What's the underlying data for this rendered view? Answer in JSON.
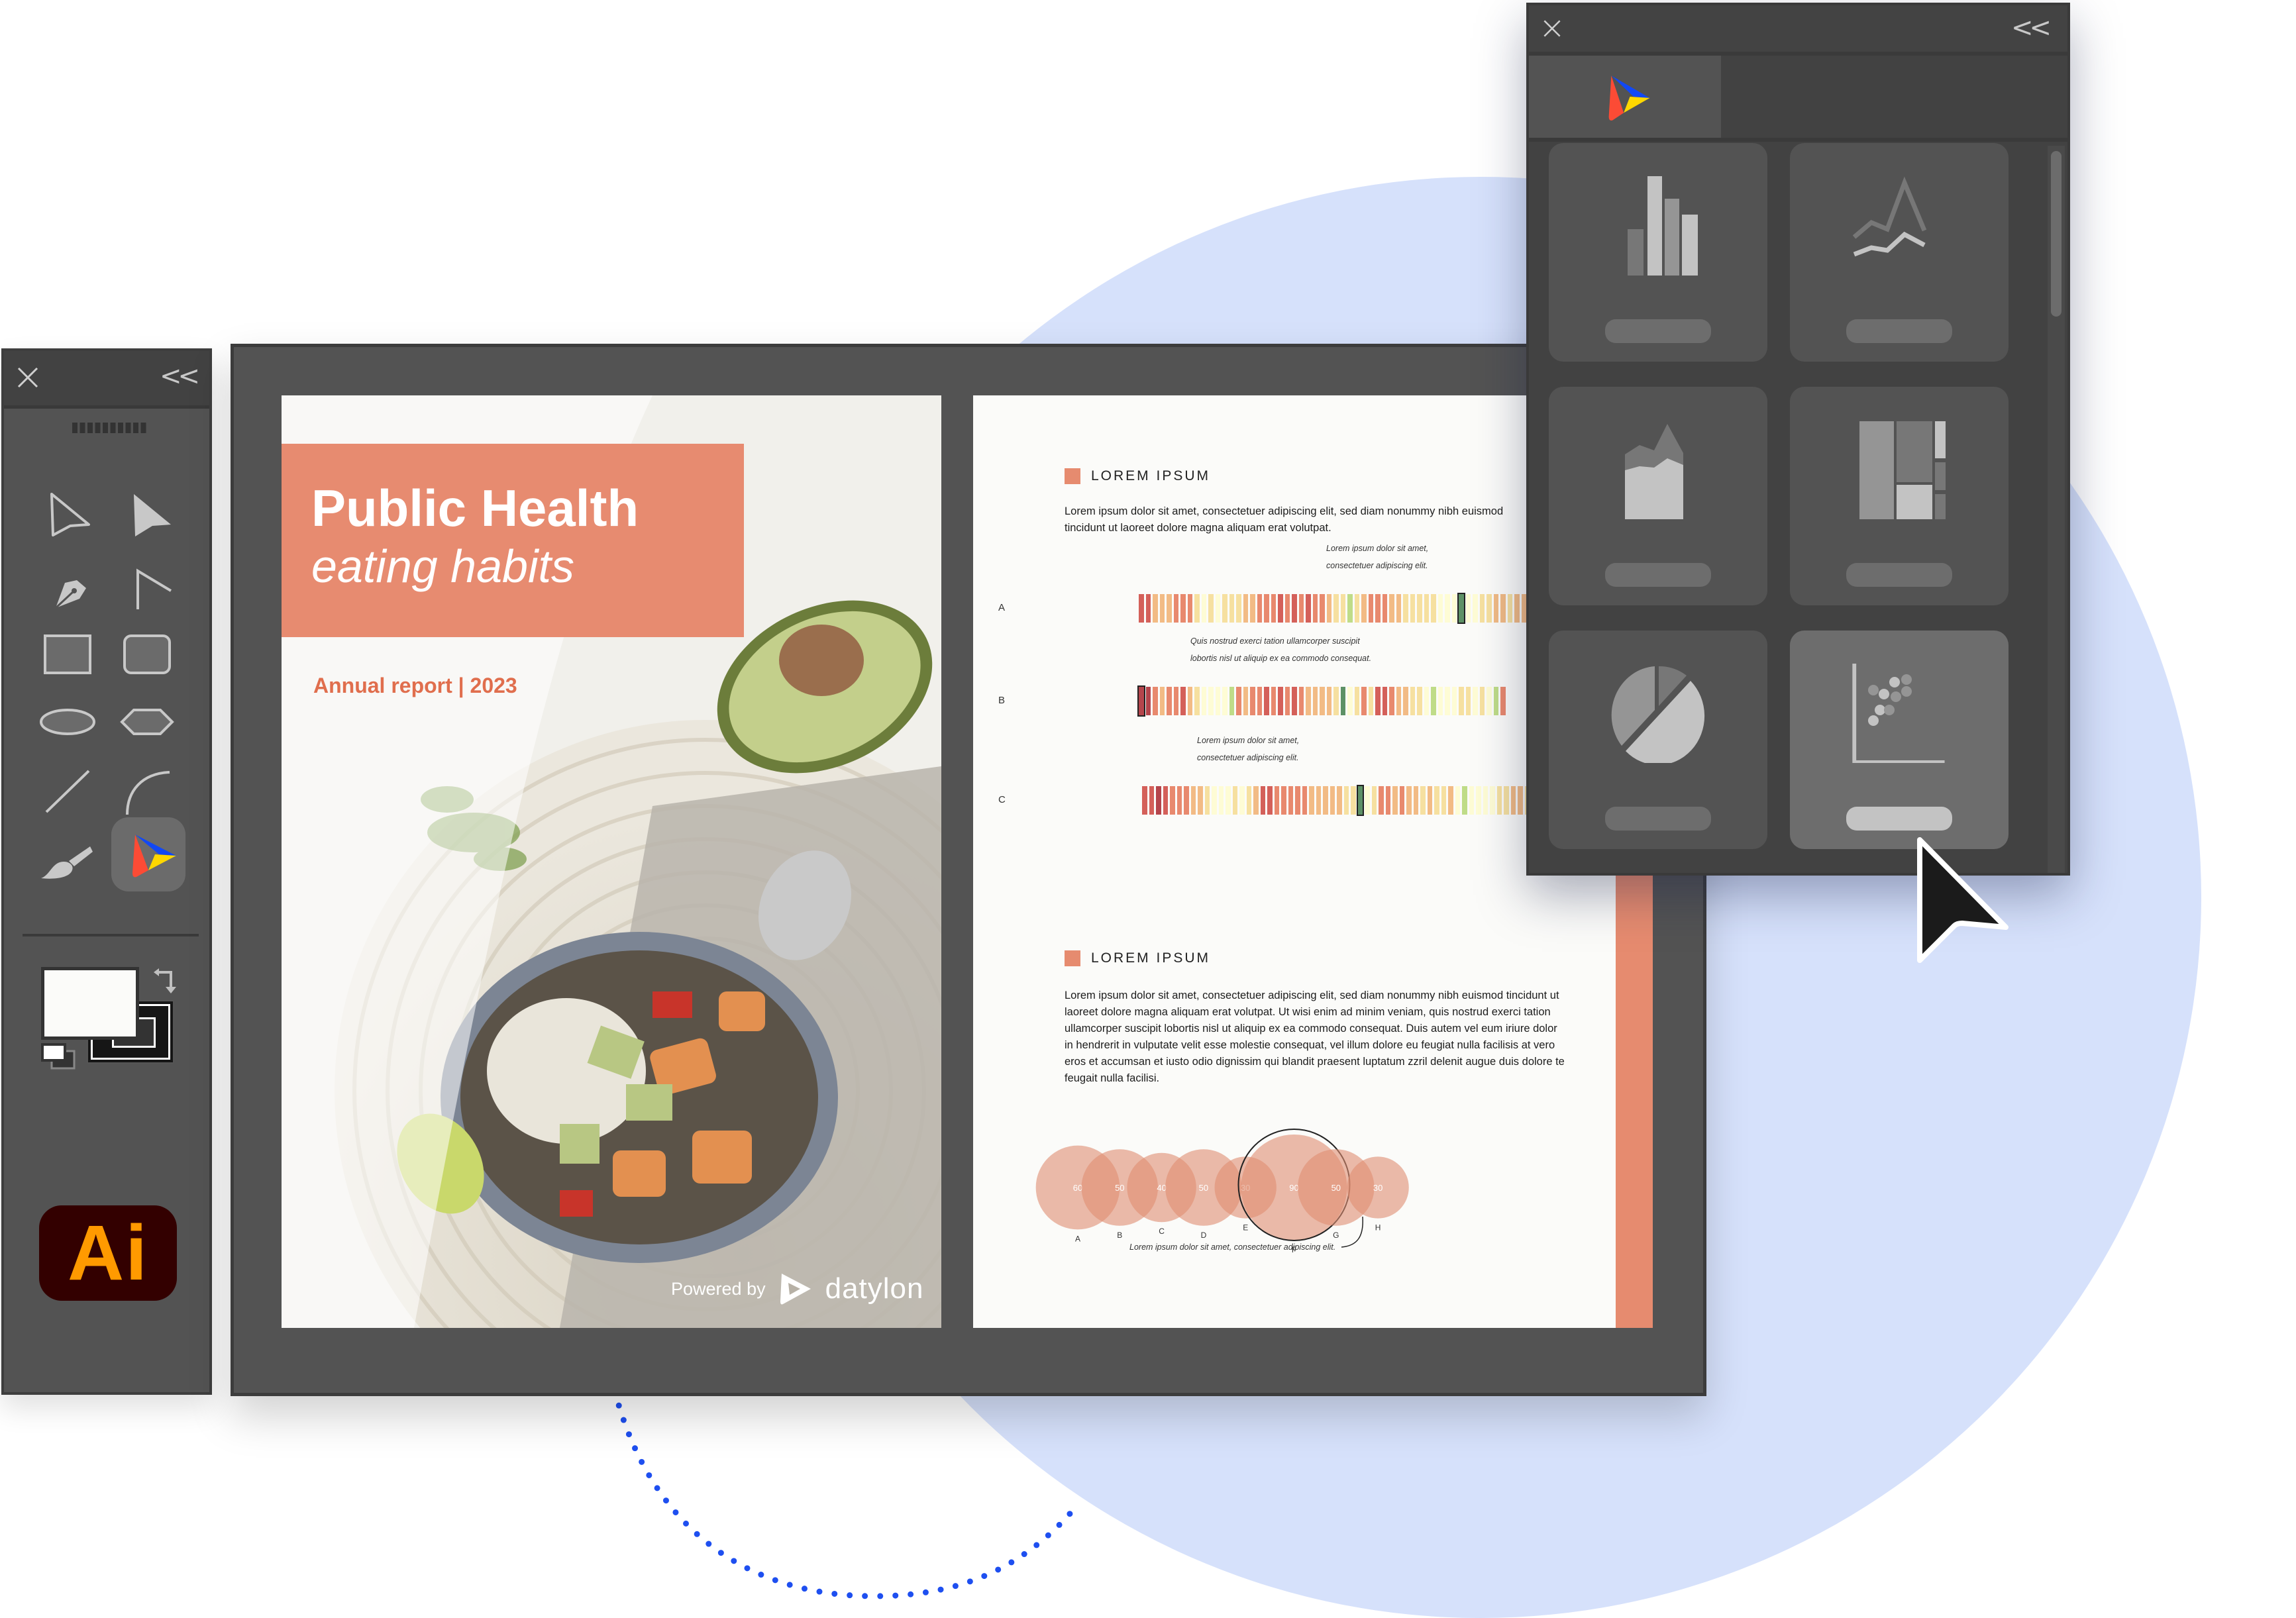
{
  "colors": {
    "accent_coral": "#e68b6f",
    "accent_text": "#e06e4d",
    "background_circle": "#d6e1fb",
    "dotted_arc": "#1e4ff0",
    "panel_dark": "#424242",
    "panel_mid": "#535353",
    "ai_logo_bg": "#330000",
    "ai_logo_fg": "#ff9a00"
  },
  "tools_panel": {
    "close_icon": "close-icon",
    "collapse_label": "<<",
    "tools": [
      {
        "name": "selection-tool",
        "icon": "arrow-outline-icon"
      },
      {
        "name": "direct-selection-tool",
        "icon": "arrow-filled-icon"
      },
      {
        "name": "pen-tool",
        "icon": "pen-nib-icon"
      },
      {
        "name": "anchor-point-tool",
        "icon": "corner-icon"
      },
      {
        "name": "rectangle-tool",
        "icon": "rectangle-icon"
      },
      {
        "name": "rounded-rectangle-tool",
        "icon": "rounded-rectangle-icon"
      },
      {
        "name": "ellipse-tool",
        "icon": "ellipse-icon"
      },
      {
        "name": "polygon-tool",
        "icon": "hexagon-icon"
      },
      {
        "name": "line-tool",
        "icon": "line-icon"
      },
      {
        "name": "arc-tool",
        "icon": "arc-icon"
      },
      {
        "name": "paintbrush-tool",
        "icon": "paintbrush-icon"
      },
      {
        "name": "datylon-tool",
        "icon": "datylon-logo-icon",
        "active": true
      }
    ],
    "fill_color": "#fbfbf9",
    "stroke_color": "#161616",
    "app_logo": "Ai"
  },
  "cover": {
    "title": "Public Health",
    "subtitle": "eating habits",
    "annual": "Annual report | 2023",
    "powered_by": "Powered by",
    "brand": "datylon"
  },
  "right_page": {
    "section1": {
      "heading": "LOREM IPSUM",
      "paragraph": "Lorem ipsum dolor sit amet, consectetuer adipiscing elit, sed diam nonummy nibh euismod tincidunt ut laoreet dolore magna aliquam erat volutpat."
    },
    "stripe_rows": [
      {
        "label": "A",
        "annotation": [
          "Lorem ipsum dolor sit amet,",
          "consectetuer adipiscing elit."
        ],
        "highlight_index": 46,
        "values": [
          1,
          1,
          3,
          3,
          3,
          2,
          2,
          2,
          4,
          5,
          4,
          5,
          4,
          4,
          4,
          3,
          3,
          2,
          2,
          2,
          1,
          2,
          1,
          2,
          1,
          2,
          2,
          3,
          4,
          4,
          6,
          4,
          3,
          2,
          2,
          2,
          3,
          3,
          4,
          4,
          4,
          4,
          4,
          5,
          5,
          5,
          7,
          5,
          5,
          4,
          4,
          3,
          3,
          4,
          3,
          3,
          3
        ]
      },
      {
        "label": "B",
        "annotation": [
          "Quis nostrud exerci tation ullamcorper suscipit",
          "lobortis nisl ut aliquip ex ea commodo consequat."
        ],
        "highlight_index": 0,
        "values": [
          0,
          0,
          2,
          3,
          2,
          2,
          1,
          3,
          4,
          5,
          5,
          5,
          5,
          6,
          2,
          3,
          2,
          2,
          1,
          2,
          1,
          2,
          1,
          2,
          3,
          3,
          3,
          3,
          4,
          7,
          5,
          4,
          2,
          4,
          1,
          1,
          2,
          3,
          3,
          4,
          4,
          5,
          6,
          5,
          5,
          5,
          4,
          4,
          5,
          4,
          5,
          6,
          2
        ]
      },
      {
        "label": "C",
        "annotation": [
          "Lorem ipsum dolor sit amet,",
          "consectetuer adipiscing elit."
        ],
        "highlight_index": 31,
        "values": [
          1,
          1,
          0,
          1,
          2,
          2,
          2,
          3,
          3,
          4,
          5,
          5,
          5,
          4,
          5,
          4,
          3,
          1,
          1,
          2,
          2,
          2,
          2,
          2,
          3,
          3,
          3,
          3,
          3,
          4,
          4,
          7,
          5,
          4,
          2,
          2,
          3,
          2,
          3,
          3,
          4,
          3,
          4,
          4,
          3,
          5,
          6,
          5,
          5,
          5,
          5,
          4,
          4,
          3,
          3,
          4,
          4
        ]
      }
    ],
    "section2": {
      "heading": "LOREM IPSUM",
      "paragraph": "Lorem ipsum dolor sit amet, consectetuer adipiscing elit, sed diam nonummy nibh euismod tincidunt ut laoreet dolore magna aliquam erat volutpat. Ut wisi enim ad minim veniam, quis nostrud exerci tation ullamcorper suscipit lobortis nisl ut aliquip ex ea commodo consequat. Duis autem vel eum iriure dolor in hendrerit in vulputate velit esse molestie consequat, vel illum dolore eu feugiat nulla facilisis at vero eros et accumsan et iusto odio dignissim qui blandit praesent luptatum zzril delenit augue duis dolore te feugait nulla facilisi."
    },
    "bubble_chart": {
      "categories": [
        "A",
        "B",
        "C",
        "D",
        "E",
        "F",
        "G",
        "H"
      ],
      "values": [
        60,
        50,
        40,
        50,
        30,
        90,
        50,
        30
      ],
      "highlight": "F",
      "annotation": "Lorem ipsum dolor sit amet, consectetuer adipiscing elit."
    }
  },
  "chart_panel": {
    "collapse_label": "<<",
    "tab": "datylon-logo-icon",
    "chart_types": [
      {
        "name": "bar-chart",
        "icon": "bar-chart-icon",
        "selected": false
      },
      {
        "name": "line-chart",
        "icon": "line-chart-icon",
        "selected": false
      },
      {
        "name": "area-chart",
        "icon": "area-chart-icon",
        "selected": false
      },
      {
        "name": "treemap",
        "icon": "treemap-icon",
        "selected": false
      },
      {
        "name": "pie-chart",
        "icon": "pie-chart-icon",
        "selected": false
      },
      {
        "name": "scatter-plot",
        "icon": "scatter-plot-icon",
        "selected": true
      }
    ]
  }
}
